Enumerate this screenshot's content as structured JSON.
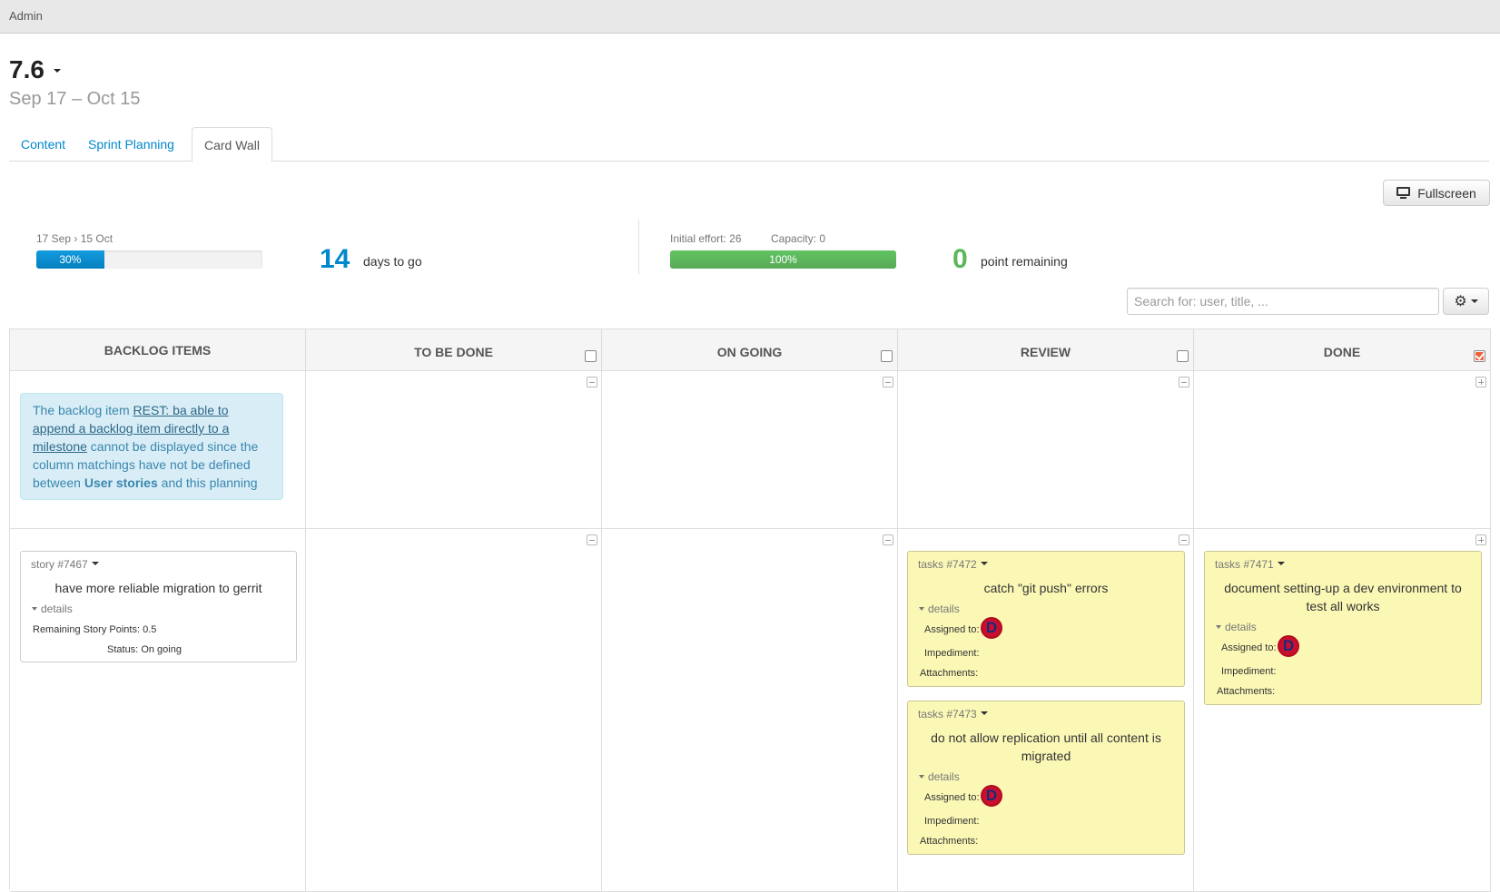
{
  "topbar": {
    "admin_label": "Admin"
  },
  "milestone": {
    "title": "7.6",
    "dates": "Sep 17 – Oct 15"
  },
  "tabs": [
    {
      "label": "Content",
      "active": false
    },
    {
      "label": "Sprint Planning",
      "active": false
    },
    {
      "label": "Card Wall",
      "active": true
    }
  ],
  "toolbar": {
    "fullscreen_label": "Fullscreen"
  },
  "stats": {
    "date_range": "17 Sep › 15 Oct",
    "time_progress_label": "30%",
    "time_progress_value": 0.3,
    "days_to_go": "14",
    "days_to_go_label": "days to go",
    "initial_effort": "Initial effort: 26",
    "capacity": "Capacity: 0",
    "effort_progress_label": "100%",
    "effort_progress_value": 1.0,
    "points_remaining": "0",
    "points_remaining_label": "point remaining"
  },
  "search": {
    "placeholder": "Search for: user, title, ..."
  },
  "columns": [
    {
      "label": "BACKLOG ITEMS"
    },
    {
      "label": "TO BE DONE",
      "checked": false
    },
    {
      "label": "ON GOING",
      "checked": false
    },
    {
      "label": "REVIEW",
      "checked": false
    },
    {
      "label": "DONE",
      "checked": true
    }
  ],
  "alert": {
    "prefix": "The backlog item ",
    "link": "REST: ba able to append a backlog item directly to a milestone",
    "middle": " cannot be displayed since the column matchings have not be defined between ",
    "bold": "User stories",
    "suffix": " and this planning"
  },
  "story": {
    "id": "story #7467",
    "title": "have more reliable migration to gerrit",
    "details_label": "details",
    "remaining_label": "Remaining Story Points:",
    "remaining_value": "0.5",
    "status_label": "Status:",
    "status_value": "On going"
  },
  "tasks": [
    {
      "id": "tasks #7472",
      "title": "catch \"git push\" errors",
      "details_label": "details",
      "assigned_label": "Assigned to:",
      "avatar_letter": "D",
      "impediment_label": "Impediment:",
      "attachments_label": "Attachments:"
    },
    {
      "id": "tasks #7473",
      "title": "do not allow replication until all content is migrated",
      "details_label": "details",
      "assigned_label": "Assigned to:",
      "avatar_letter": "D",
      "impediment_label": "Impediment:",
      "attachments_label": "Attachments:"
    },
    {
      "id": "tasks #7471",
      "title": "document setting-up a dev environment to test all works",
      "details_label": "details",
      "assigned_label": "Assigned to:",
      "avatar_letter": "D",
      "impediment_label": "Impediment:",
      "attachments_label": "Attachments:"
    }
  ],
  "colors": {
    "accent_blue": "#0088cc",
    "green": "#5bb75b",
    "card_yellow": "#fbf8b6",
    "alert_bg": "#d9edf7"
  }
}
